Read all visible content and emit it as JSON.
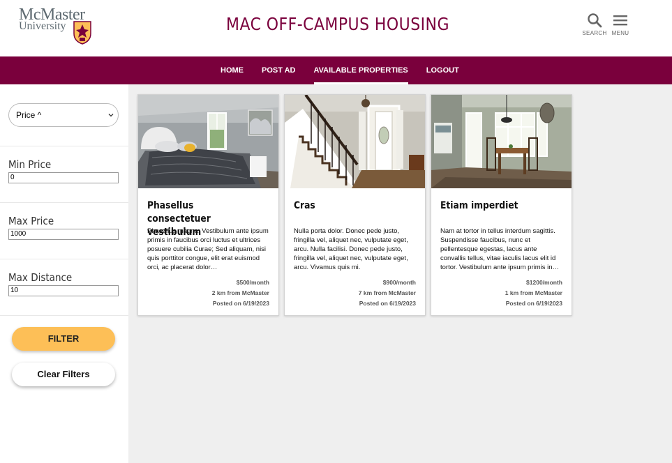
{
  "header": {
    "logo_line1": "McMaster",
    "logo_line2": "University",
    "title": "MAC OFF-CAMPUS HOUSING",
    "search_label": "SEARCH",
    "menu_label": "MENU"
  },
  "nav": {
    "items": [
      {
        "label": "HOME"
      },
      {
        "label": "POST AD"
      },
      {
        "label": "AVAILABLE PROPERTIES"
      },
      {
        "label": "LOGOUT"
      }
    ],
    "active": "AVAILABLE PROPERTIES"
  },
  "sidebar": {
    "sort_value": "Price ^",
    "min_price_label": "Min Price",
    "min_price_value": "0",
    "max_price_label": "Max Price",
    "max_price_value": "1000",
    "max_distance_label": "Max Distance",
    "max_distance_value": "10",
    "filter_label": "FILTER",
    "clear_label": "Clear Filters"
  },
  "listings": [
    {
      "title": "Phasellus consectetuer vestibulum",
      "description": "Phasellus magna. Vestibulum ante ipsum primis in faucibus orci luctus et ultrices posuere cubilia Curae; Sed aliquam, nisi quis porttitor congue, elit erat euismod orci, ac placerat dolor…",
      "price": "$500/month",
      "distance": "2 km from McMaster",
      "posted": "Posted on 6/19/2023",
      "image": "bedroom-photo"
    },
    {
      "title": "Cras",
      "description": "Nulla porta dolor. Donec pede justo, fringilla vel, aliquet nec, vulputate eget, arcu. Nulla facilisi. Donec pede justo, fringilla vel, aliquet nec, vulputate eget, arcu. Vivamus quis mi.",
      "price": "$900/month",
      "distance": "7 km from McMaster",
      "posted": "Posted on 6/19/2023",
      "image": "entryway-stairs-photo"
    },
    {
      "title": "Etiam imperdiet",
      "description": "Nam at tortor in tellus interdum sagittis. Suspendisse faucibus, nunc et pellentesque egestas, lacus ante convallis tellus, vitae iaculis lacus elit id tortor. Vestibulum ante ipsum primis in…",
      "price": "$1200/month",
      "distance": "1 km from McMaster",
      "posted": "Posted on 6/19/2023",
      "image": "dining-room-photo"
    }
  ],
  "colors": {
    "brand_maroon": "#7a003c",
    "brand_gold": "#fdbf57",
    "main_bg": "#efefef"
  }
}
